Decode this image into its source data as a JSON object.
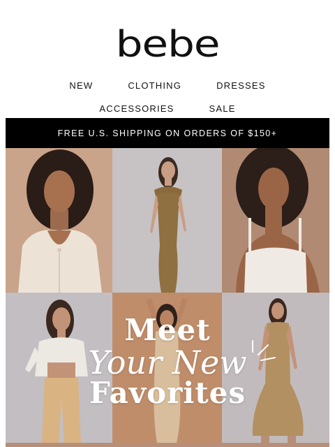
{
  "brand": {
    "logo_text": "bebe"
  },
  "nav": {
    "row1": [
      {
        "label": "NEW"
      },
      {
        "label": "CLOTHING"
      },
      {
        "label": "DRESSES"
      }
    ],
    "row2": [
      {
        "label": "ACCESSORIES"
      },
      {
        "label": "SALE"
      }
    ]
  },
  "banner": {
    "text": "FREE U.S. SHIPPING ON ORDERS OF $150+"
  },
  "hero": {
    "line1": "Meet",
    "line2": "Your New",
    "line3": "Favorites"
  },
  "colors": {
    "banner_bg": "#000000",
    "banner_text": "#ffffff",
    "headline": "#ffffff"
  }
}
